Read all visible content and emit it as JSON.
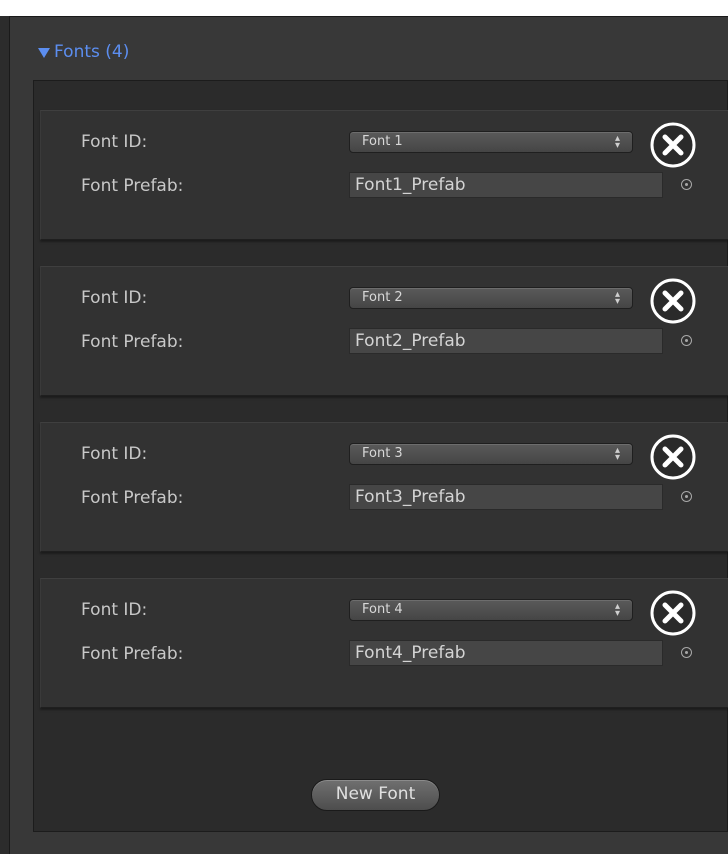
{
  "section": {
    "title": "Fonts (4)",
    "colors": {
      "foldout_text": "#5c8ef0",
      "panel_bg": "#2b2b2b",
      "card_bg": "#323232"
    }
  },
  "labels": {
    "font_id": "Font ID:",
    "font_prefab": "Font Prefab:"
  },
  "fonts": [
    {
      "id_value": "Font 1",
      "prefab_value": "Font1_Prefab"
    },
    {
      "id_value": "Font 2",
      "prefab_value": "Font2_Prefab"
    },
    {
      "id_value": "Font 3",
      "prefab_value": "Font3_Prefab"
    },
    {
      "id_value": "Font 4",
      "prefab_value": "Font4_Prefab"
    }
  ],
  "icons": {
    "remove": "circle-x-icon",
    "object_picker": "target-circle-icon",
    "dropdown": "up-down-arrows-icon",
    "foldout": "triangle-down-icon"
  },
  "new_font_button": "New Font"
}
